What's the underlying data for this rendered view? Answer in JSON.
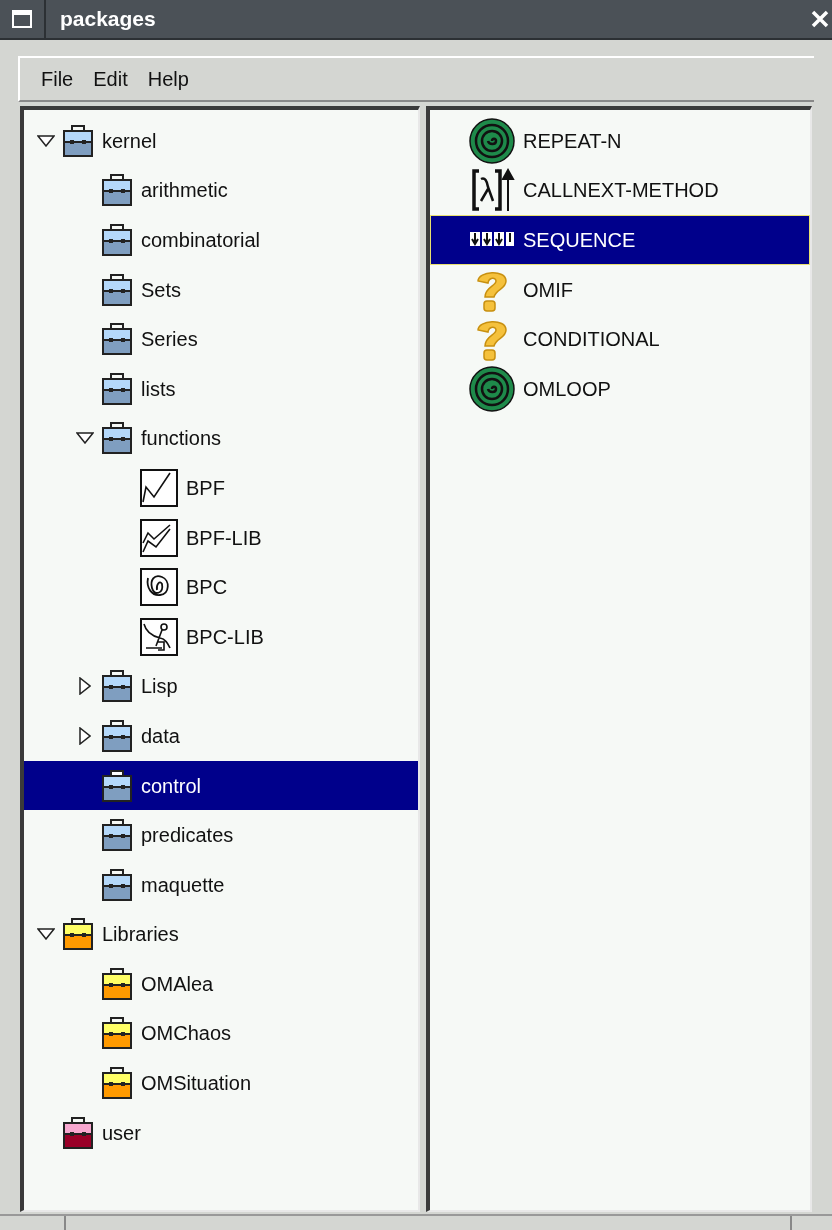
{
  "window": {
    "title": "packages"
  },
  "menu": [
    "File",
    "Edit",
    "Help"
  ],
  "tree": [
    {
      "label": "kernel",
      "kind": "kernel-package",
      "expanded": true,
      "selected": false,
      "children": [
        {
          "label": "arithmetic",
          "kind": "kernel-package",
          "selected": false
        },
        {
          "label": "combinatorial",
          "kind": "kernel-package",
          "selected": false
        },
        {
          "label": "Sets",
          "kind": "kernel-package",
          "selected": false
        },
        {
          "label": "Series",
          "kind": "kernel-package",
          "selected": false
        },
        {
          "label": "lists",
          "kind": "kernel-package",
          "selected": false
        },
        {
          "label": "functions",
          "kind": "kernel-package",
          "expanded": true,
          "selected": false,
          "children": [
            {
              "label": "BPF",
              "kind": "bpf",
              "selected": false
            },
            {
              "label": "BPF-LIB",
              "kind": "bpf-lib",
              "selected": false
            },
            {
              "label": "BPC",
              "kind": "bpc",
              "selected": false
            },
            {
              "label": "BPC-LIB",
              "kind": "bpc-lib",
              "selected": false
            }
          ]
        },
        {
          "label": "Lisp",
          "kind": "kernel-package",
          "expanded": false,
          "selected": false
        },
        {
          "label": "data",
          "kind": "kernel-package",
          "expanded": false,
          "selected": false
        },
        {
          "label": "control",
          "kind": "kernel-package",
          "selected": true
        },
        {
          "label": "predicates",
          "kind": "kernel-package",
          "selected": false
        },
        {
          "label": "maquette",
          "kind": "kernel-package",
          "selected": false
        }
      ]
    },
    {
      "label": "Libraries",
      "kind": "library-package",
      "expanded": true,
      "selected": false,
      "children": [
        {
          "label": "OMAlea",
          "kind": "library-package",
          "selected": false
        },
        {
          "label": "OMChaos",
          "kind": "library-package",
          "selected": false
        },
        {
          "label": "OMSituation",
          "kind": "library-package",
          "selected": false
        }
      ]
    },
    {
      "label": "user",
      "kind": "user-package",
      "selected": false
    }
  ],
  "items": [
    {
      "label": "REPEAT-N",
      "kind": "loop",
      "selected": false
    },
    {
      "label": "CALLNEXT-METHOD",
      "kind": "callnext",
      "selected": false
    },
    {
      "label": "SEQUENCE",
      "kind": "sequence",
      "selected": true
    },
    {
      "label": "OMIF",
      "kind": "question",
      "selected": false
    },
    {
      "label": "CONDITIONAL",
      "kind": "question",
      "selected": false
    },
    {
      "label": "OMLOOP",
      "kind": "loop",
      "selected": false
    }
  ]
}
